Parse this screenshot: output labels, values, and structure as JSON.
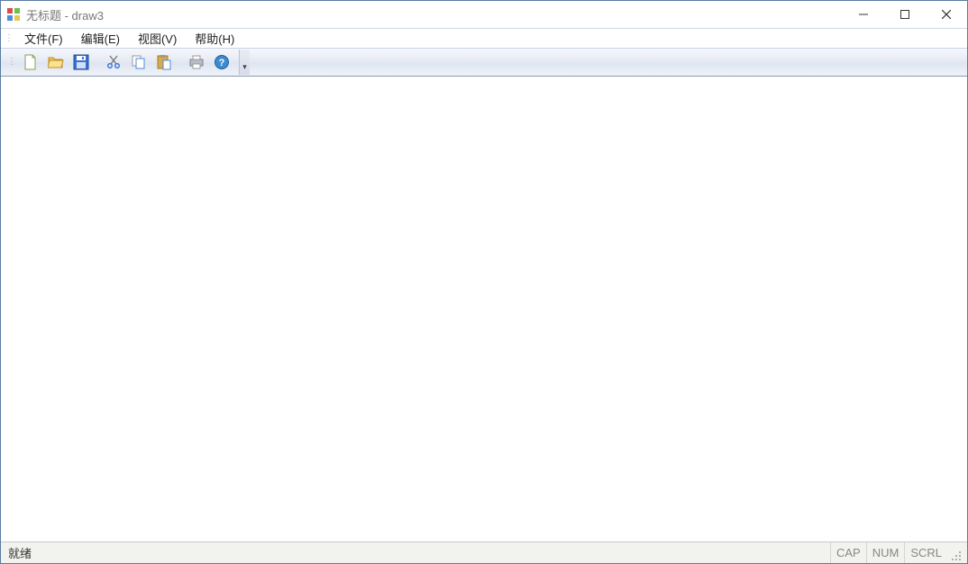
{
  "title": "无标题 - draw3",
  "menu": {
    "file": "文件(F)",
    "edit": "编辑(E)",
    "view": "视图(V)",
    "help": "帮助(H)"
  },
  "toolbar": {
    "new": "new-file-icon",
    "open": "open-folder-icon",
    "save": "save-disk-icon",
    "cut": "cut-scissors-icon",
    "copy": "copy-pages-icon",
    "paste": "paste-clipboard-icon",
    "print": "printer-icon",
    "help": "help-question-icon"
  },
  "status": {
    "ready": "就绪",
    "cap": "CAP",
    "num": "NUM",
    "scrl": "SCRL"
  }
}
